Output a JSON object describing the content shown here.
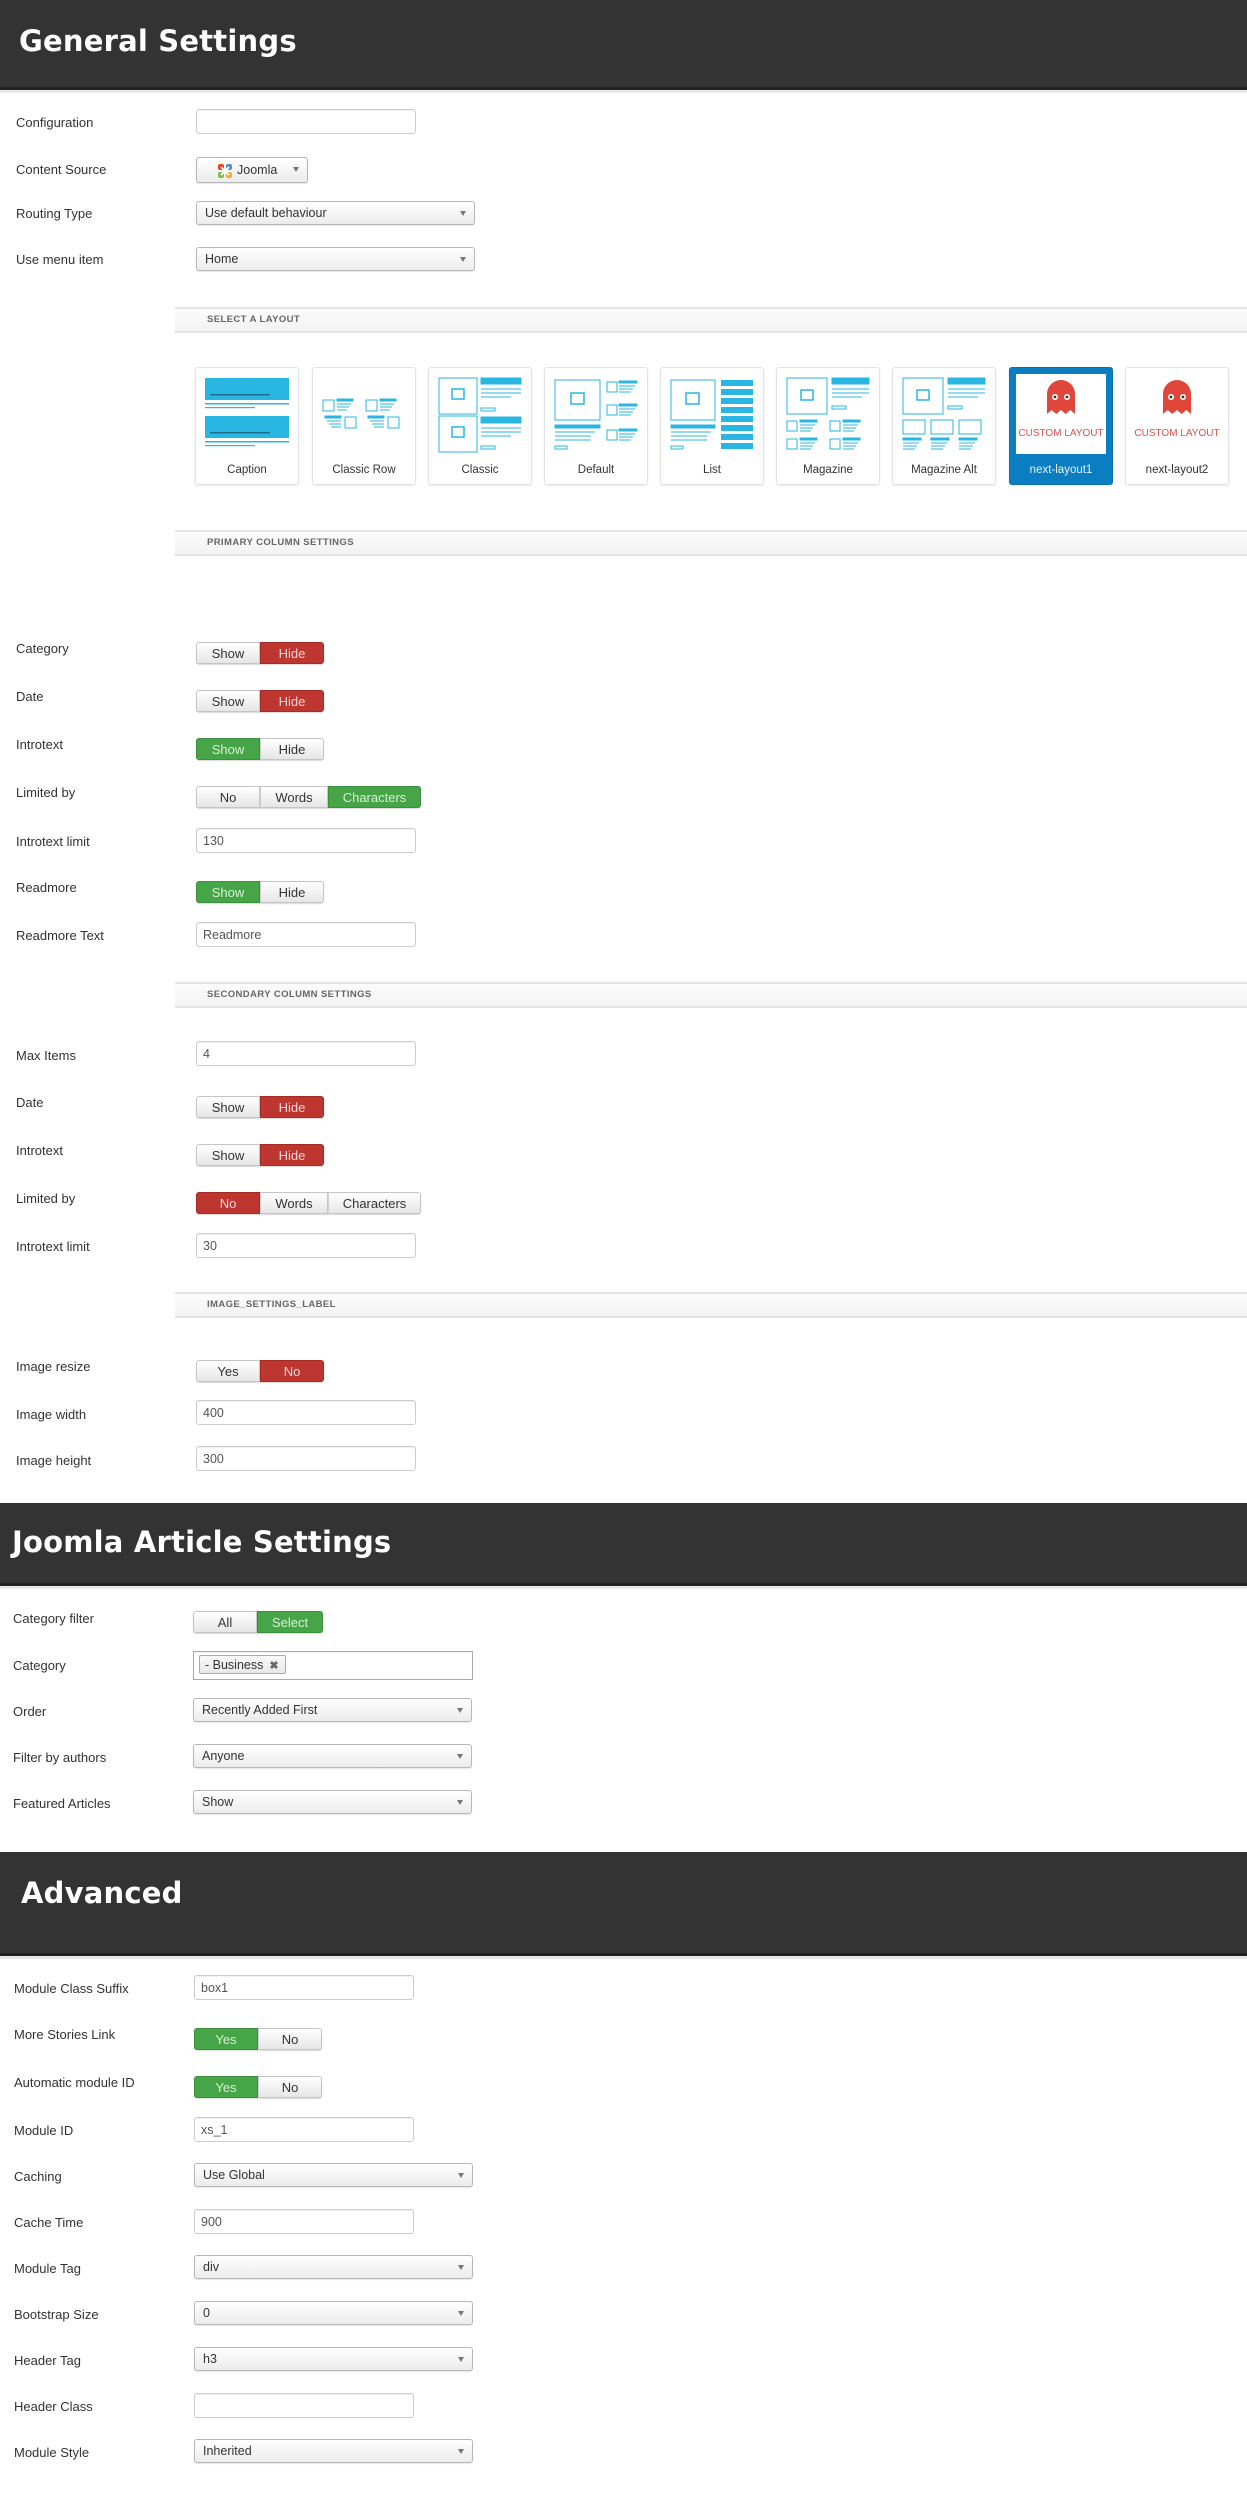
{
  "sections": {
    "general": {
      "title": "General Settings"
    },
    "joomla": {
      "title": "Joomla Article Settings"
    },
    "advanced": {
      "title": "Advanced"
    }
  },
  "general": {
    "configuration": {
      "label": "Configuration",
      "value": ""
    },
    "content_source": {
      "label": "Content Source",
      "value": "Joomla",
      "icon": "joomla-logo-icon"
    },
    "routing_type": {
      "label": "Routing Type",
      "value": "Use default behaviour"
    },
    "use_menu_item": {
      "label": "Use menu item",
      "value": "Home"
    }
  },
  "layout": {
    "section_label": "SELECT A LAYOUT",
    "selected": "next-layout1",
    "cards": [
      {
        "name": "Caption",
        "thumb": "caption"
      },
      {
        "name": "Classic Row",
        "thumb": "classic-row"
      },
      {
        "name": "Classic",
        "thumb": "classic"
      },
      {
        "name": "Default",
        "thumb": "default"
      },
      {
        "name": "List",
        "thumb": "list"
      },
      {
        "name": "Magazine",
        "thumb": "magazine"
      },
      {
        "name": "Magazine Alt",
        "thumb": "magazine-alt"
      },
      {
        "name": "next-layout1",
        "thumb": "custom",
        "thumb_text": "CUSTOM LAYOUT"
      },
      {
        "name": "next-layout2",
        "thumb": "custom",
        "thumb_text": "CUSTOM LAYOUT"
      }
    ]
  },
  "primary": {
    "section_label": "PRIMARY COLUMN SETTINGS",
    "category": {
      "label": "Category",
      "options": [
        "Show",
        "Hide"
      ],
      "selected": "Hide"
    },
    "date": {
      "label": "Date",
      "options": [
        "Show",
        "Hide"
      ],
      "selected": "Hide"
    },
    "introtext": {
      "label": "Introtext",
      "options": [
        "Show",
        "Hide"
      ],
      "selected": "Show"
    },
    "limited_by": {
      "label": "Limited by",
      "options": [
        "No",
        "Words",
        "Characters"
      ],
      "selected": "Characters"
    },
    "introtext_limit": {
      "label": "Introtext limit",
      "value": "130"
    },
    "readmore": {
      "label": "Readmore",
      "options": [
        "Show",
        "Hide"
      ],
      "selected": "Show"
    },
    "readmore_text": {
      "label": "Readmore Text",
      "value": "Readmore"
    }
  },
  "secondary": {
    "section_label": "SECONDARY COLUMN SETTINGS",
    "max_items": {
      "label": "Max Items",
      "value": "4"
    },
    "date": {
      "label": "Date",
      "options": [
        "Show",
        "Hide"
      ],
      "selected": "Hide"
    },
    "introtext": {
      "label": "Introtext",
      "options": [
        "Show",
        "Hide"
      ],
      "selected": "Hide"
    },
    "limited_by": {
      "label": "Limited by",
      "options": [
        "No",
        "Words",
        "Characters"
      ],
      "selected": "No"
    },
    "introtext_limit": {
      "label": "Introtext limit",
      "value": "30"
    }
  },
  "image": {
    "section_label": "IMAGE_SETTINGS_LABEL",
    "resize": {
      "label": "Image resize",
      "options": [
        "Yes",
        "No"
      ],
      "selected": "No"
    },
    "width": {
      "label": "Image width",
      "value": "400"
    },
    "height": {
      "label": "Image height",
      "value": "300"
    }
  },
  "joomla": {
    "category_filter": {
      "label": "Category filter",
      "options": [
        "All",
        "Select"
      ],
      "selected": "Select"
    },
    "category": {
      "label": "Category",
      "tags": [
        "- Business"
      ],
      "remove_glyph": "✖"
    },
    "order": {
      "label": "Order",
      "value": "Recently Added First"
    },
    "filter_by_authors": {
      "label": "Filter by authors",
      "value": "Anyone"
    },
    "featured_articles": {
      "label": "Featured Articles",
      "value": "Show"
    }
  },
  "advanced": {
    "module_class_suffix": {
      "label": "Module Class Suffix",
      "value": "box1"
    },
    "more_stories_link": {
      "label": "More Stories Link",
      "options": [
        "Yes",
        "No"
      ],
      "selected": "Yes"
    },
    "automatic_module_id": {
      "label": "Automatic module ID",
      "options": [
        "Yes",
        "No"
      ],
      "selected": "Yes"
    },
    "module_id": {
      "label": "Module ID",
      "value": "xs_1"
    },
    "caching": {
      "label": "Caching",
      "value": "Use Global"
    },
    "cache_time": {
      "label": "Cache Time",
      "value": "900"
    },
    "module_tag": {
      "label": "Module Tag",
      "value": "div"
    },
    "bootstrap_size": {
      "label": "Bootstrap Size",
      "value": "0"
    },
    "header_tag": {
      "label": "Header Tag",
      "value": "h3"
    },
    "header_class": {
      "label": "Header Class",
      "value": ""
    },
    "module_style": {
      "label": "Module Style",
      "value": "Inherited"
    }
  },
  "colors": {
    "header_bg": "#333333",
    "active_red": "#bd362f",
    "active_green": "#46a546",
    "selected_card": "#0b7dc1",
    "thumb_blue": "#29b6e3",
    "ghost_red": "#e0463a"
  }
}
